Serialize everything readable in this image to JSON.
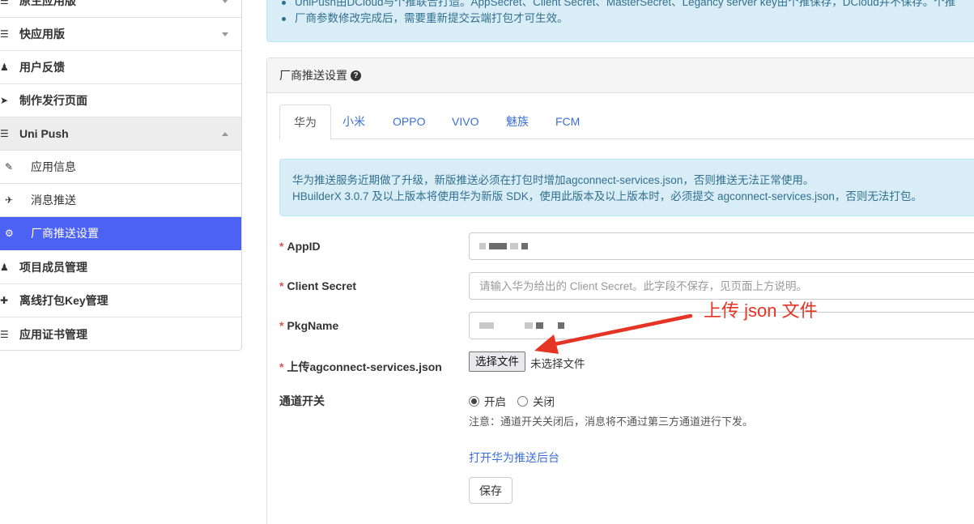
{
  "sidebar": {
    "items": [
      {
        "label": "原生应用版",
        "icon": "list-icon",
        "caret": "down"
      },
      {
        "label": "快应用版",
        "icon": "list-icon",
        "caret": "down"
      },
      {
        "label": "用户反馈",
        "icon": "user-icon"
      },
      {
        "label": "制作发行页面",
        "icon": "arrow-right-icon"
      },
      {
        "label": "Uni Push",
        "icon": "list-icon",
        "caret": "up"
      },
      {
        "label": "应用信息",
        "icon": "edit-icon"
      },
      {
        "label": "消息推送",
        "icon": "send-icon"
      },
      {
        "label": "厂商推送设置",
        "icon": "gear-icon"
      },
      {
        "label": "项目成员管理",
        "icon": "user-icon"
      },
      {
        "label": "离线打包Key管理",
        "icon": "plus-icon"
      },
      {
        "label": "应用证书管理",
        "icon": "list-icon"
      }
    ],
    "active_color": "#4b62f5"
  },
  "top_notice": {
    "lines": [
      "UniPush由DCloud与个推联合打造。AppSecret、Client Secret、MasterSecret、Legancy server key由个推保存，DCloud并不保存。个推",
      "厂商参数修改完成后，需要重新提交云端打包才可生效。"
    ]
  },
  "panel": {
    "title": "厂商推送设置",
    "help_icon": "question-circle-icon",
    "tabs": [
      "华为",
      "小米",
      "OPPO",
      "VIVO",
      "魅族",
      "FCM"
    ],
    "active_tab": "华为",
    "info": [
      "华为推送服务近期做了升级，新版推送必须在打包时增加agconnect-services.json，否则推送无法正常使用。",
      "HBuilderX 3.0.7 及以上版本将使用华为新版 SDK，使用此版本及以上版本时，必须提交 agconnect-services.json，否则无法打包。"
    ],
    "form": {
      "required_mark": "*",
      "appid_label": "AppID",
      "client_secret_label": "Client Secret",
      "client_secret_placeholder": "请输入华为给出的 Client Secret。此字段不保存，见页面上方说明。",
      "pkgname_label": "PkgName",
      "upload_label": "上传agconnect-services.json",
      "file_button": "选择文件",
      "file_status": "未选择文件",
      "channel_label": "通道开关",
      "radio_on": "开启",
      "radio_off": "关闭",
      "channel_value": "开启",
      "channel_hint": "注意：通道开关关闭后，消息将不通过第三方通道进行下发。",
      "console_link": "打开华为推送后台",
      "save_button": "保存"
    }
  },
  "annotation": {
    "text": "上传 json 文件",
    "color": "#e53324"
  }
}
